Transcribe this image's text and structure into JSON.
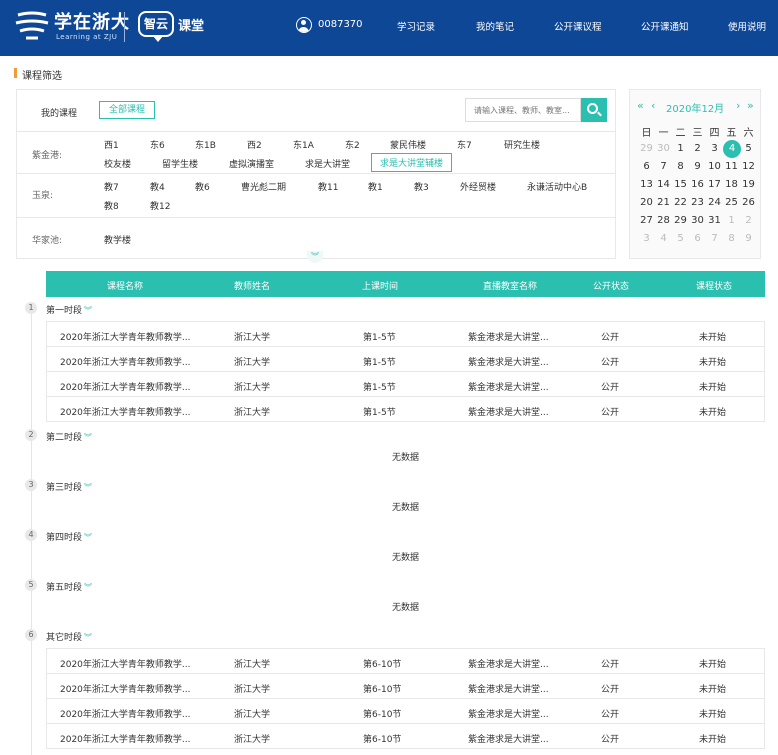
{
  "header": {
    "brand": "学在浙大",
    "brand_sub": "Learning at ZJU",
    "zy": "智云",
    "kt": "课堂",
    "user_id": "0087370",
    "nav": [
      "学习记录",
      "我的笔记",
      "公开课议程",
      "公开课通知",
      "使用说明"
    ],
    "bg_color": "#0f4797"
  },
  "section_title": "课程筛选",
  "filter": {
    "my_course_label": "我的课程",
    "all_course": "全部课程",
    "search_placeholder": "请输入课程、教师、教室...",
    "zijingang_label": "紫金港:",
    "zijingang": [
      "西1",
      "东6",
      "东1B",
      "西2",
      "东1A",
      "东2",
      "蒙民伟楼",
      "东7",
      "研究生楼",
      "校友楼",
      "留学生楼",
      "虚拟演播室",
      "求是大讲堂",
      "求是大讲堂辅楼"
    ],
    "yuquan_label": "玉泉:",
    "yuquan": [
      "教7",
      "教4",
      "教6",
      "曹光彪二期",
      "教11",
      "教1",
      "教3",
      "外经贸楼",
      "永谦活动中心B",
      "教8",
      "教12"
    ],
    "huajiachi_label": "华家池:",
    "huajiachi": [
      "教学楼"
    ],
    "accent": "#2bbfb0"
  },
  "calendar": {
    "title": "2020年12月",
    "weekdays": [
      "日",
      "一",
      "二",
      "三",
      "四",
      "五",
      "六"
    ],
    "days": [
      [
        "29",
        "30",
        "1",
        "2",
        "3",
        "4",
        "5"
      ],
      [
        "6",
        "7",
        "8",
        "9",
        "10",
        "11",
        "12"
      ],
      [
        "13",
        "14",
        "15",
        "16",
        "17",
        "18",
        "19"
      ],
      [
        "20",
        "21",
        "22",
        "23",
        "24",
        "25",
        "26"
      ],
      [
        "27",
        "28",
        "29",
        "30",
        "31",
        "1",
        "2"
      ],
      [
        "3",
        "4",
        "5",
        "6",
        "7",
        "8",
        "9"
      ]
    ],
    "selected": "4"
  },
  "table": {
    "headers": [
      "课程名称",
      "教师姓名",
      "上课时间",
      "直播教室名称",
      "公开状态",
      "课程状态"
    ],
    "no_data": "无数据",
    "segments": [
      {
        "num": "1",
        "label": "第一时段",
        "rows": [
          [
            "2020年浙江大学青年教师教学...",
            "浙江大学",
            "第1-5节",
            "紫金港求是大讲堂...",
            "公开",
            "未开始"
          ],
          [
            "2020年浙江大学青年教师教学...",
            "浙江大学",
            "第1-5节",
            "紫金港求是大讲堂...",
            "公开",
            "未开始"
          ],
          [
            "2020年浙江大学青年教师教学...",
            "浙江大学",
            "第1-5节",
            "紫金港求是大讲堂...",
            "公开",
            "未开始"
          ],
          [
            "2020年浙江大学青年教师教学...",
            "浙江大学",
            "第1-5节",
            "紫金港求是大讲堂...",
            "公开",
            "未开始"
          ]
        ]
      },
      {
        "num": "2",
        "label": "第二时段",
        "rows": []
      },
      {
        "num": "3",
        "label": "第三时段",
        "rows": []
      },
      {
        "num": "4",
        "label": "第四时段",
        "rows": []
      },
      {
        "num": "5",
        "label": "第五时段",
        "rows": []
      },
      {
        "num": "6",
        "label": "其它时段",
        "rows": [
          [
            "2020年浙江大学青年教师教学...",
            "浙江大学",
            "第6-10节",
            "紫金港求是大讲堂...",
            "公开",
            "未开始"
          ],
          [
            "2020年浙江大学青年教师教学...",
            "浙江大学",
            "第6-10节",
            "紫金港求是大讲堂...",
            "公开",
            "未开始"
          ],
          [
            "2020年浙江大学青年教师教学...",
            "浙江大学",
            "第6-10节",
            "紫金港求是大讲堂...",
            "公开",
            "未开始"
          ],
          [
            "2020年浙江大学青年教师教学...",
            "浙江大学",
            "第6-10节",
            "紫金港求是大讲堂...",
            "公开",
            "未开始"
          ]
        ]
      }
    ]
  }
}
